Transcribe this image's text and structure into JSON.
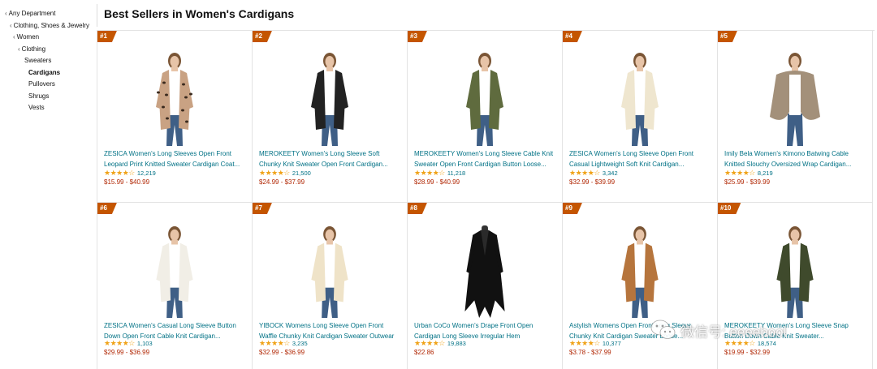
{
  "sidebar": {
    "items": [
      {
        "label": "Any Department",
        "level": 0,
        "chevron": true
      },
      {
        "label": "Clothing, Shoes & Jewelry",
        "level": 1,
        "chevron": true
      },
      {
        "label": "Women",
        "level": 2,
        "chevron": true
      },
      {
        "label": "Clothing",
        "level": 3,
        "chevron": true
      },
      {
        "label": "Sweaters",
        "level": 4,
        "chevron": false
      },
      {
        "label": "Cardigans",
        "level": 5,
        "chevron": false,
        "active": true
      },
      {
        "label": "Pullovers",
        "level": 5,
        "chevron": false
      },
      {
        "label": "Shrugs",
        "level": 5,
        "chevron": false
      },
      {
        "label": "Vests",
        "level": 5,
        "chevron": false
      }
    ]
  },
  "heading": "Best Sellers in Women's Cardigans",
  "colors": {
    "badge": "#c45500",
    "link": "#007185",
    "price": "#b12704",
    "star": "#f0a216"
  },
  "products": [
    {
      "rank": "#1",
      "title": "ZESICA Women's Long Sleeves Open Front Leopard Print Knitted Sweater Cardigan Coat...",
      "rating_count": "12,219",
      "price": "$15.99 - $40.99",
      "stars": 4.5,
      "image": {
        "name": "leopard-cardigan-image",
        "style": "leopard",
        "color": "#c9a283"
      }
    },
    {
      "rank": "#2",
      "title": "MEROKEETY Women's Long Sleeve Soft Chunky Knit Sweater Open Front Cardigan...",
      "rating_count": "21,500",
      "price": "$24.99 - $37.99",
      "stars": 4.5,
      "image": {
        "name": "black-cardigan-image",
        "style": "plain",
        "color": "#222222"
      }
    },
    {
      "rank": "#3",
      "title": "MEROKEETY Women's Long Sleeve Cable Knit Sweater Open Front Cardigan Button Loose...",
      "rating_count": "11,218",
      "price": "$28.99 - $40.99",
      "stars": 4.5,
      "image": {
        "name": "olive-cardigan-image",
        "style": "plain",
        "color": "#5f6b3e"
      }
    },
    {
      "rank": "#4",
      "title": "ZESICA Women's Long Sleeve Open Front Casual Lightweight Soft Knit Cardigan...",
      "rating_count": "3,342",
      "price": "$32.99 - $39.99",
      "stars": 4.5,
      "image": {
        "name": "cream-cardigan-image",
        "style": "plain",
        "color": "#efe6cf"
      }
    },
    {
      "rank": "#5",
      "title": "Imily Bela Women's Kimono Batwing Cable Knitted Slouchy Oversized Wrap Cardigan...",
      "rating_count": "8,219",
      "price": "$25.99 - $39.99",
      "stars": 4.0,
      "image": {
        "name": "taupe-wrap-cardigan-image",
        "style": "wrap",
        "color": "#a3907a"
      }
    },
    {
      "rank": "#6",
      "title": "ZESICA Women's Casual Long Sleeve Button Down Open Front Cable Knit Cardigan...",
      "rating_count": "1,103",
      "price": "$29.99 - $36.99",
      "stars": 4.5,
      "image": {
        "name": "white-button-cardigan-image",
        "style": "plain",
        "color": "#f1eee6"
      }
    },
    {
      "rank": "#7",
      "title": "YIBOCK Womens Long Sleeve Open Front Waffle Chunky Knit Cardigan Sweater Outwear",
      "rating_count": "3,235",
      "price": "$32.99 - $36.99",
      "stars": 4.5,
      "image": {
        "name": "beige-waffle-cardigan-image",
        "style": "plain",
        "color": "#efe3c8"
      }
    },
    {
      "rank": "#8",
      "title": "Urban CoCo Women's Drape Front Open Cardigan Long Sleeve Irregular Hem",
      "rating_count": "19,883",
      "price": "$22.86",
      "stars": 4.5,
      "image": {
        "name": "black-drape-cardigan-image",
        "style": "drape",
        "color": "#111111"
      }
    },
    {
      "rank": "#9",
      "title": "Astylish Womens Open Front Long Sleeve Chunky Knit Cardigan Sweater Loose...",
      "rating_count": "10,377",
      "price": "$3.78 - $37.99",
      "stars": 4.5,
      "image": {
        "name": "camel-knit-cardigan-image",
        "style": "plain",
        "color": "#b6753d"
      }
    },
    {
      "rank": "#10",
      "title": "MEROKEETY Women's Long Sleeve Snap Button Down Cable Knit Sweater...",
      "rating_count": "18,574",
      "price": "$19.99 - $32.99",
      "stars": 4.5,
      "image": {
        "name": "olive-snap-cardigan-image",
        "style": "plain",
        "color": "#3f4a2c"
      }
    }
  ],
  "watermark": {
    "text": "微信号: eeeebool"
  }
}
